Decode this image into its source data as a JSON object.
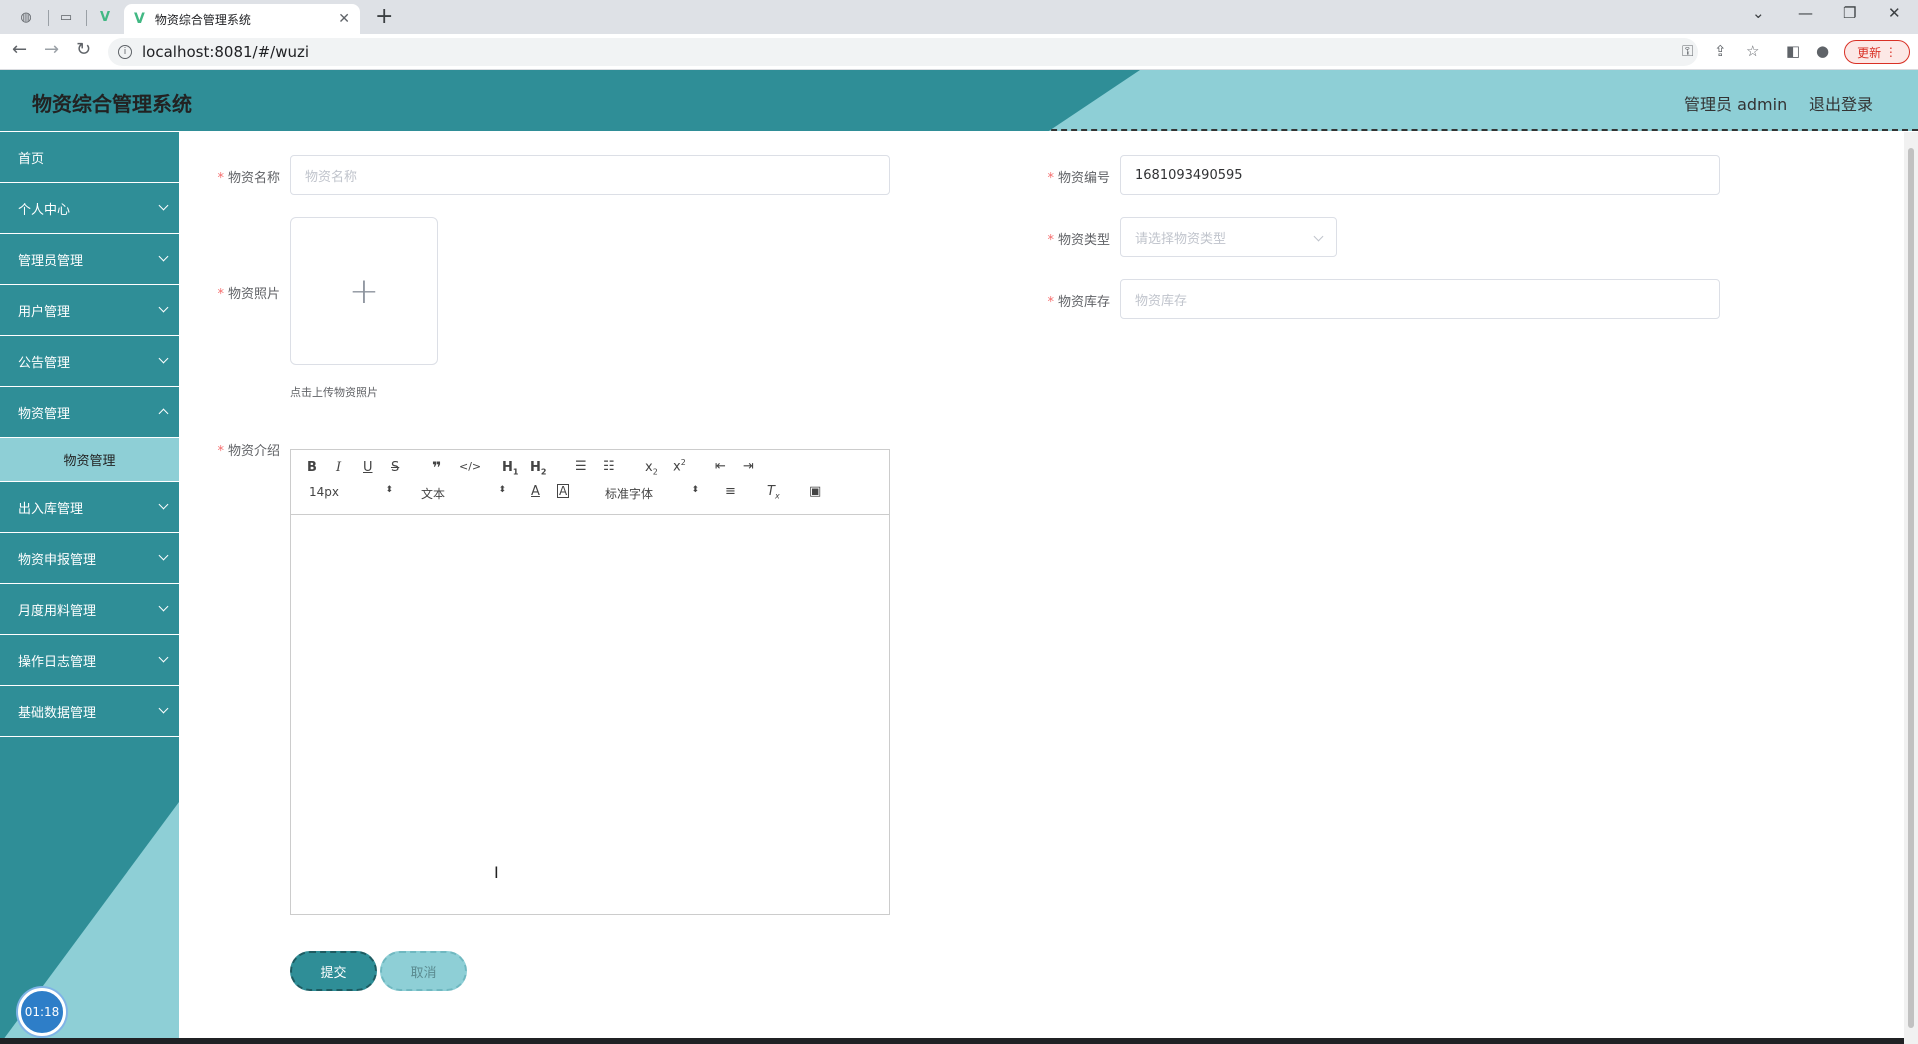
{
  "browser": {
    "tab_title": "物资综合管理系统",
    "url": "localhost:8081/#/wuzi",
    "update_label": "更新"
  },
  "header": {
    "title": "物资综合管理系统",
    "user": "管理员 admin",
    "logout": "退出登录"
  },
  "sidebar": {
    "items": [
      {
        "label": "首页"
      },
      {
        "label": "个人中心"
      },
      {
        "label": "管理员管理"
      },
      {
        "label": "用户管理"
      },
      {
        "label": "公告管理"
      },
      {
        "label": "物资管理"
      },
      {
        "label": "物资管理"
      },
      {
        "label": "出入库管理"
      },
      {
        "label": "物资申报管理"
      },
      {
        "label": "月度用料管理"
      },
      {
        "label": "操作日志管理"
      },
      {
        "label": "基础数据管理"
      }
    ],
    "clock": "01:18"
  },
  "form": {
    "name_label": "物资名称",
    "name_placeholder": "物资名称",
    "code_label": "物资编号",
    "code_value": "1681093490595",
    "photo_label": "物资照片",
    "photo_tip": "点击上传物资照片",
    "type_label": "物资类型",
    "type_placeholder": "请选择物资类型",
    "stock_label": "物资库存",
    "stock_placeholder": "物资库存",
    "intro_label": "物资介绍"
  },
  "editor": {
    "font_size": "14px",
    "header_select": "文本",
    "font_family": "标准字体"
  },
  "buttons": {
    "submit": "提交",
    "cancel": "取消"
  }
}
